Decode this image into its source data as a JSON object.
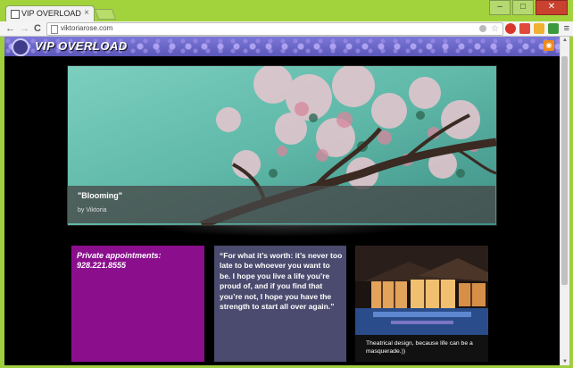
{
  "browser": {
    "tab_title": "VIP OVERLOAD",
    "tab_close": "×",
    "url": "viktoriarose.com",
    "back": "←",
    "forward": "→",
    "reload": "C",
    "star": "☆",
    "menu": "≡",
    "window": {
      "minimize": "–",
      "maximize": "□",
      "close": "✕"
    }
  },
  "site": {
    "title": "VIP OVERLOAD",
    "rss": "◉"
  },
  "hero": {
    "title": "\"Blooming\"",
    "subtitle": "by Viktoria"
  },
  "boxes": {
    "appointments": {
      "line1": "Private appointments:",
      "phone": "928.221.8555"
    },
    "quote": {
      "text": "“For what it’s worth: it’s never too late to be whoever you want to be. I hope you live a life you’re proud of, and if you find that you’re not, I hope you have the strength to start all over again.”"
    },
    "photo": {
      "caption": "Theatrical design, because life can be a masquerade.))"
    }
  },
  "colors": {
    "browser_frame": "#9fce3f",
    "header": "#6a66c8",
    "appointments_box": "#8b0e8d",
    "quote_box": "#4b4b6f",
    "page_bg": "#000000"
  },
  "icons": [
    "page-icon",
    "back-icon",
    "forward-icon",
    "reload-icon",
    "star-icon",
    "menu-icon",
    "rss-icon"
  ]
}
